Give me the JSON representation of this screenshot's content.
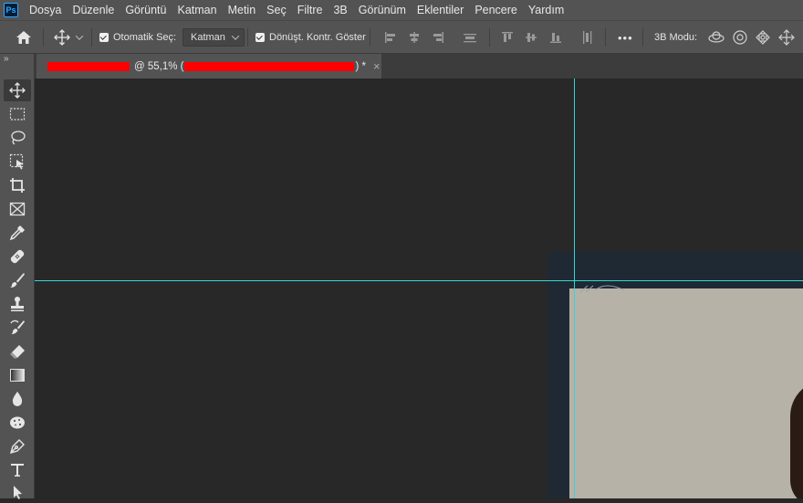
{
  "app": {
    "logo_text": "Ps"
  },
  "menu": [
    "Dosya",
    "Düzenle",
    "Görüntü",
    "Katman",
    "Metin",
    "Seç",
    "Filtre",
    "3B",
    "Görünüm",
    "Eklentiler",
    "Pencere",
    "Yardım"
  ],
  "options": {
    "auto_select_label": "Otomatik Seç:",
    "auto_select_value": "Katman",
    "transform_controls_label": "Dönüşt. Kontr. Göster",
    "more_label": "•••",
    "mode_3d_label": "3B Modu:"
  },
  "toolbar": {
    "collapse_label": "»",
    "tools": [
      "move-tool",
      "marquee-tool",
      "lasso-tool",
      "object-selection-tool",
      "crop-tool",
      "frame-tool",
      "eyedropper-tool",
      "healing-brush-tool",
      "brush-tool",
      "clone-stamp-tool",
      "history-brush-tool",
      "eraser-tool",
      "gradient-tool",
      "blur-tool",
      "sponge-tool",
      "pen-tool",
      "type-tool",
      "path-selection-tool"
    ]
  },
  "document": {
    "zoom_text": "@ 55,1% (",
    "tail_text": ") *",
    "close_label": "×"
  },
  "colors": {
    "accent_guides": "#33d6d6",
    "redaction": "#ff0000",
    "ui_panel": "#535353",
    "canvas_bg": "#282828"
  }
}
